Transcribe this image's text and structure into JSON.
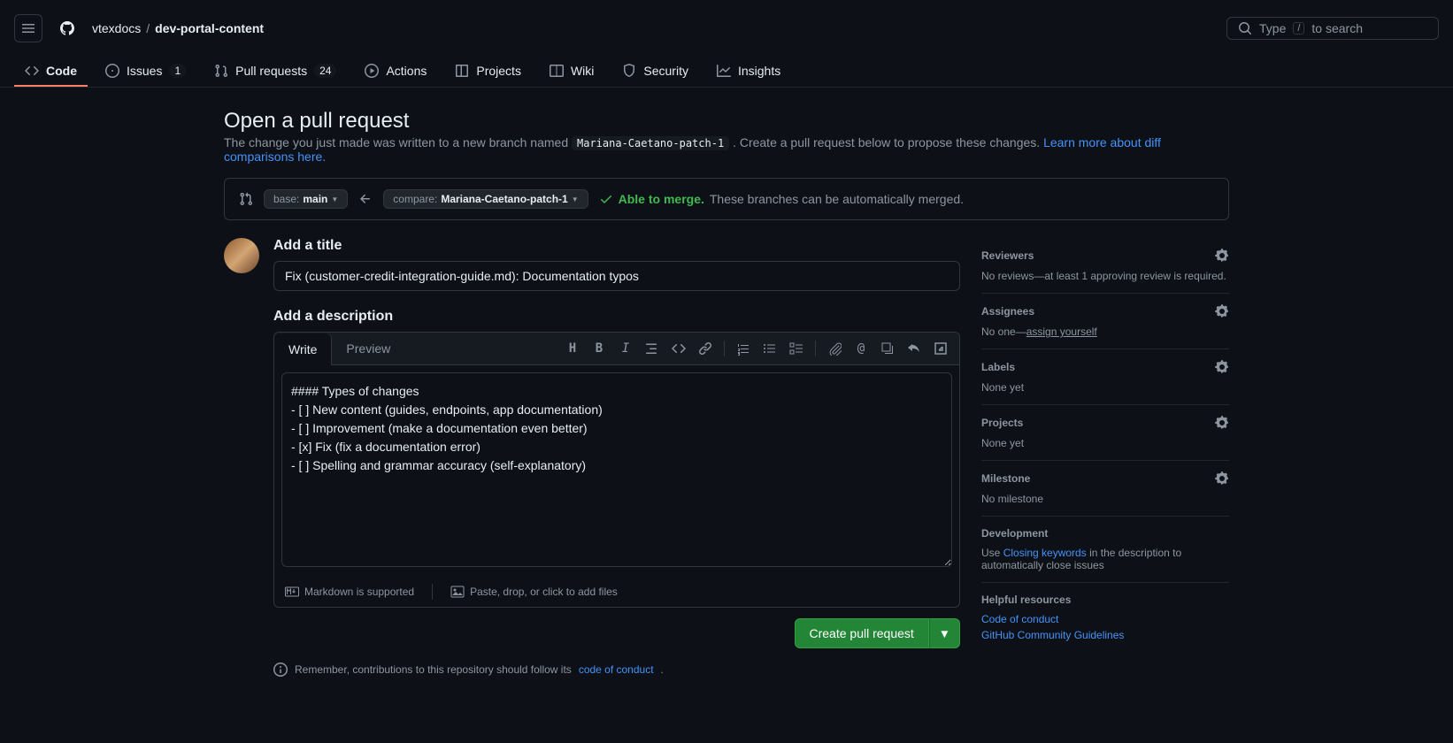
{
  "header": {
    "owner": "vtexdocs",
    "repo": "dev-portal-content",
    "search_placeholder": "Type / to search"
  },
  "nav": {
    "code": "Code",
    "issues": "Issues",
    "issues_count": "1",
    "pulls": "Pull requests",
    "pulls_count": "24",
    "actions": "Actions",
    "projects": "Projects",
    "wiki": "Wiki",
    "security": "Security",
    "insights": "Insights"
  },
  "page": {
    "title": "Open a pull request",
    "subtitle_pre": "The change you just made was written to a new branch named ",
    "branch_code": "Mariana-Caetano-patch-1",
    "subtitle_post": " . Create a pull request below to propose these changes. ",
    "learn_link": "Learn more about diff comparisons here."
  },
  "branches": {
    "base_label": "base: ",
    "base_value": "main",
    "compare_label": "compare: ",
    "compare_value": "Mariana-Caetano-patch-1",
    "able_label": "Able to merge.",
    "able_rest": " These branches can be automatically merged."
  },
  "form": {
    "title_label": "Add a title",
    "title_value": "Fix (customer-credit-integration-guide.md): Documentation typos",
    "desc_label": "Add a description",
    "write_tab": "Write",
    "preview_tab": "Preview",
    "body": "#### Types of changes\n- [ ] New content (guides, endpoints, app documentation)\n- [ ] Improvement (make a documentation even better)\n- [x] Fix (fix a documentation error)\n- [ ] Spelling and grammar accuracy (self-explanatory)",
    "markdown_note": "Markdown is supported",
    "paste_note": "Paste, drop, or click to add files",
    "submit": "Create pull request",
    "contrib_pre": "Remember, contributions to this repository should follow its ",
    "contrib_link": "code of conduct",
    "contrib_post": "."
  },
  "sidebar": {
    "reviewers": {
      "title": "Reviewers",
      "body": "No reviews—at least 1 approving review is required."
    },
    "assignees": {
      "title": "Assignees",
      "body_pre": "No one—",
      "assign": "assign yourself"
    },
    "labels": {
      "title": "Labels",
      "body": "None yet"
    },
    "projects": {
      "title": "Projects",
      "body": "None yet"
    },
    "milestone": {
      "title": "Milestone",
      "body": "No milestone"
    },
    "development": {
      "title": "Development",
      "body_pre": "Use ",
      "link": "Closing keywords",
      "body_post": " in the description to automatically close issues"
    },
    "resources": {
      "title": "Helpful resources",
      "coc": "Code of conduct",
      "guidelines": "GitHub Community Guidelines"
    }
  }
}
